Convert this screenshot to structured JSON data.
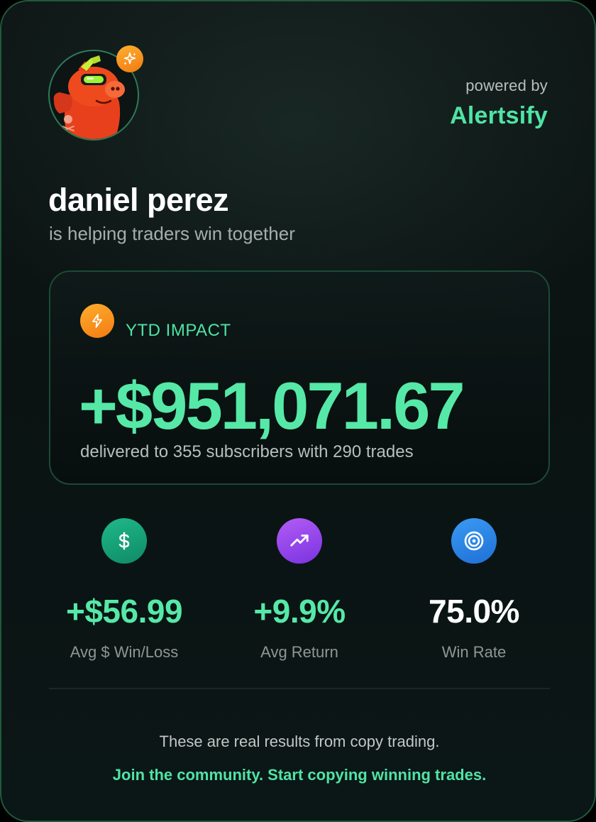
{
  "header": {
    "avatar_icon": "cartoon-pig-avatar",
    "badge_icon": "sparkle-icon",
    "powered_by": "powered by",
    "brand": "Alertsify"
  },
  "profile": {
    "name": "daniel perez",
    "tagline": "is helping traders win together"
  },
  "impact": {
    "icon": "lightning-bolt-icon",
    "label": "YTD IMPACT",
    "value": "+$951,071.67",
    "subtext": "delivered to 355 subscribers with 290 trades"
  },
  "stats": [
    {
      "icon": "dollar-sign-icon",
      "value": "+$56.99",
      "label": "Avg $ Win/Loss",
      "color": "#56e8a7"
    },
    {
      "icon": "trending-up-icon",
      "value": "+9.9%",
      "label": "Avg Return",
      "color": "#56e8a7"
    },
    {
      "icon": "target-icon",
      "value": "75.0%",
      "label": "Win Rate",
      "color": "#ffffff"
    }
  ],
  "footer": {
    "note": "These are real results from copy trading.",
    "cta": "Join the community. Start copying winning trades."
  },
  "colors": {
    "accent": "#4fe3a5",
    "orange": "#f5951f",
    "border": "#1f5a3d"
  }
}
